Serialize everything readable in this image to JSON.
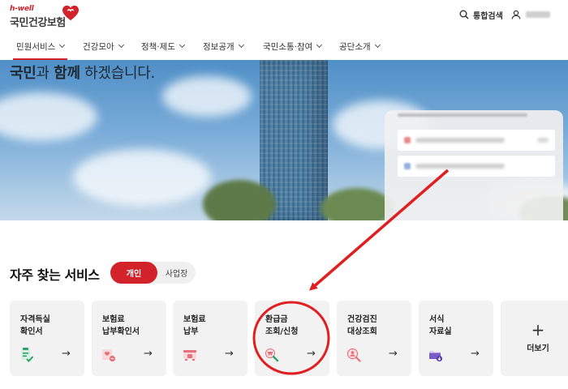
{
  "header": {
    "logo_small": "h-well",
    "logo_main": "국민건강보험",
    "search_label": "통합검색",
    "icons": {
      "search": "search-icon",
      "user": "user-icon"
    }
  },
  "nav": {
    "items": [
      {
        "label": "민원서비스",
        "active": true
      },
      {
        "label": "건강모아",
        "active": false
      },
      {
        "label": "정책·제도",
        "active": false
      },
      {
        "label": "정보공개",
        "active": false
      },
      {
        "label": "국민소통·참여",
        "active": false
      },
      {
        "label": "공단소개",
        "active": false
      }
    ]
  },
  "hero": {
    "text_bold1": "국민",
    "text_mid": "과 ",
    "text_bold2": "함께",
    "text_tail": " 하겠습니다."
  },
  "services": {
    "title": "자주 찾는 서비스",
    "toggle": {
      "individual": "개인",
      "business": "사업장",
      "selected": "개인"
    },
    "cards": [
      {
        "label": "자격득실\n확인서",
        "icon": "document-check-icon"
      },
      {
        "label": "보험료\n납부확인서",
        "icon": "receipt-heart-icon"
      },
      {
        "label": "보험료\n납부",
        "icon": "payment-cart-icon"
      },
      {
        "label": "환급금\n조회/신청",
        "icon": "refund-search-icon"
      },
      {
        "label": "건강검진\n대상조회",
        "icon": "person-search-icon"
      },
      {
        "label": "서식\n자료실",
        "icon": "folder-download-icon"
      }
    ],
    "more_label": "더보기",
    "arrow": "→",
    "plus": "+"
  },
  "colors": {
    "brand_red": "#d2232a",
    "card_bg": "#f2f2f2",
    "icon_green": "#2aa56a",
    "icon_pink": "#e8707a",
    "icon_purple": "#7a5cc8"
  }
}
